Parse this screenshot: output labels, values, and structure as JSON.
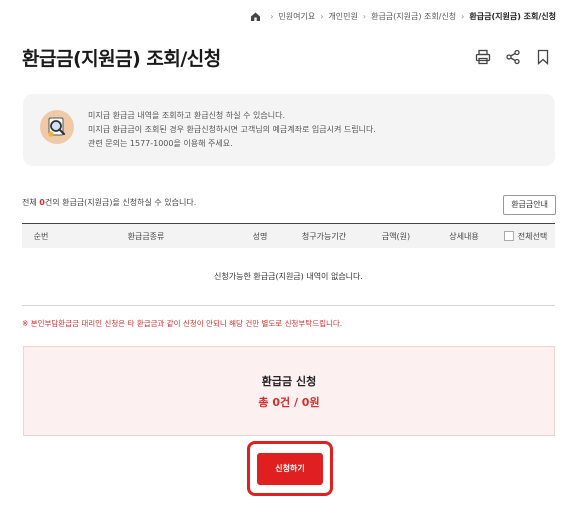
{
  "breadcrumb": {
    "items": [
      "민원여기요",
      "개인민원",
      "환급금(지원금) 조회/신청",
      "환급금(지원금) 조회/신청"
    ]
  },
  "page": {
    "title": "환급금(지원금) 조회/신청",
    "actions": [
      "print-icon",
      "share-icon",
      "bookmark-icon"
    ]
  },
  "info": {
    "icon": "magnifier-document-icon",
    "lines": [
      "미지급 환급금 내역을 조회하고 환급신청 하실 수 있습니다.",
      "미지급 환급금이 조회된 경우 환급신청하시면 고객님의 예금계좌로 입금시켜 드립니다.",
      "관련 문의는 1577-1000을 이용해 주세요."
    ]
  },
  "count": {
    "prefix": "전체 ",
    "value": "0",
    "suffix": "건의 환급금(지원금)을 신청하실 수 있습니다."
  },
  "guide_button": "환급금안내",
  "table": {
    "columns": [
      "순번",
      "환급금종류",
      "성명",
      "청구가능기간",
      "금액(원)",
      "상세내용",
      "전체선택"
    ],
    "empty_message": "신청가능한 환급금(지원금) 내역이 없습니다."
  },
  "notice": "※ 본인부담환급금 대리인 신청은 타 환급금과 같이 신청이 안되니 해당 건만 별도로 신청부탁드립니다.",
  "summary": {
    "title": "환급금 신청",
    "total": "총 0건 / 0원"
  },
  "apply_button": "신청하기",
  "colors": {
    "accent": "#e02020",
    "highlight_text": "#d32f2f",
    "summary_bg": "#fdf0f0",
    "info_bg": "#f4f4f4"
  }
}
